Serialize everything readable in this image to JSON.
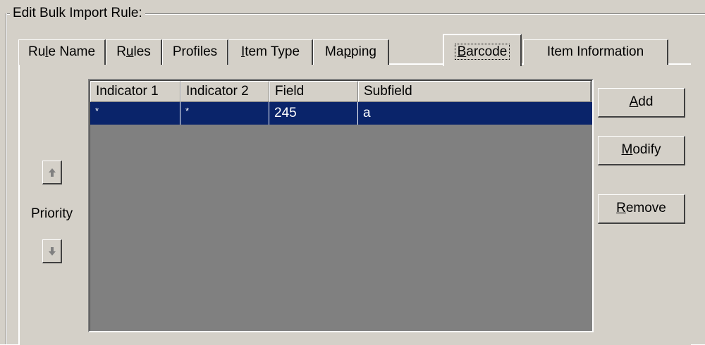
{
  "group": {
    "title": "Edit  Bulk Import Rule:"
  },
  "tabs": [
    {
      "label": "Rule Name",
      "accel": "l",
      "selected": false
    },
    {
      "label": "Rules",
      "accel": "u",
      "selected": false
    },
    {
      "label": "Profiles",
      "accel": "",
      "selected": false
    },
    {
      "label": "Item Type",
      "accel": "I",
      "selected": false
    },
    {
      "label": "Mapping",
      "accel": "p",
      "selected": false
    },
    {
      "label": "Barcode",
      "accel": "B",
      "selected": true
    },
    {
      "label": "Item Information",
      "accel": "",
      "selected": false
    }
  ],
  "grid": {
    "headers": [
      "Indicator 1",
      "Indicator 2",
      "Field",
      "Subfield"
    ],
    "rows": [
      {
        "cells": [
          "*",
          "*",
          "245",
          "a"
        ],
        "selected": true
      }
    ]
  },
  "buttons": {
    "add": {
      "label": "Add",
      "accel": "A"
    },
    "modify": {
      "label": "Modify",
      "accel": "M"
    },
    "remove": {
      "label": "Remove",
      "accel": "R"
    }
  },
  "priority": {
    "label": "Priority",
    "up_icon": "arrow-up-icon",
    "down_icon": "arrow-down-icon"
  },
  "colors": {
    "selection": "#0a246a",
    "grid_background": "#808080",
    "face": "#d4d0c8"
  }
}
